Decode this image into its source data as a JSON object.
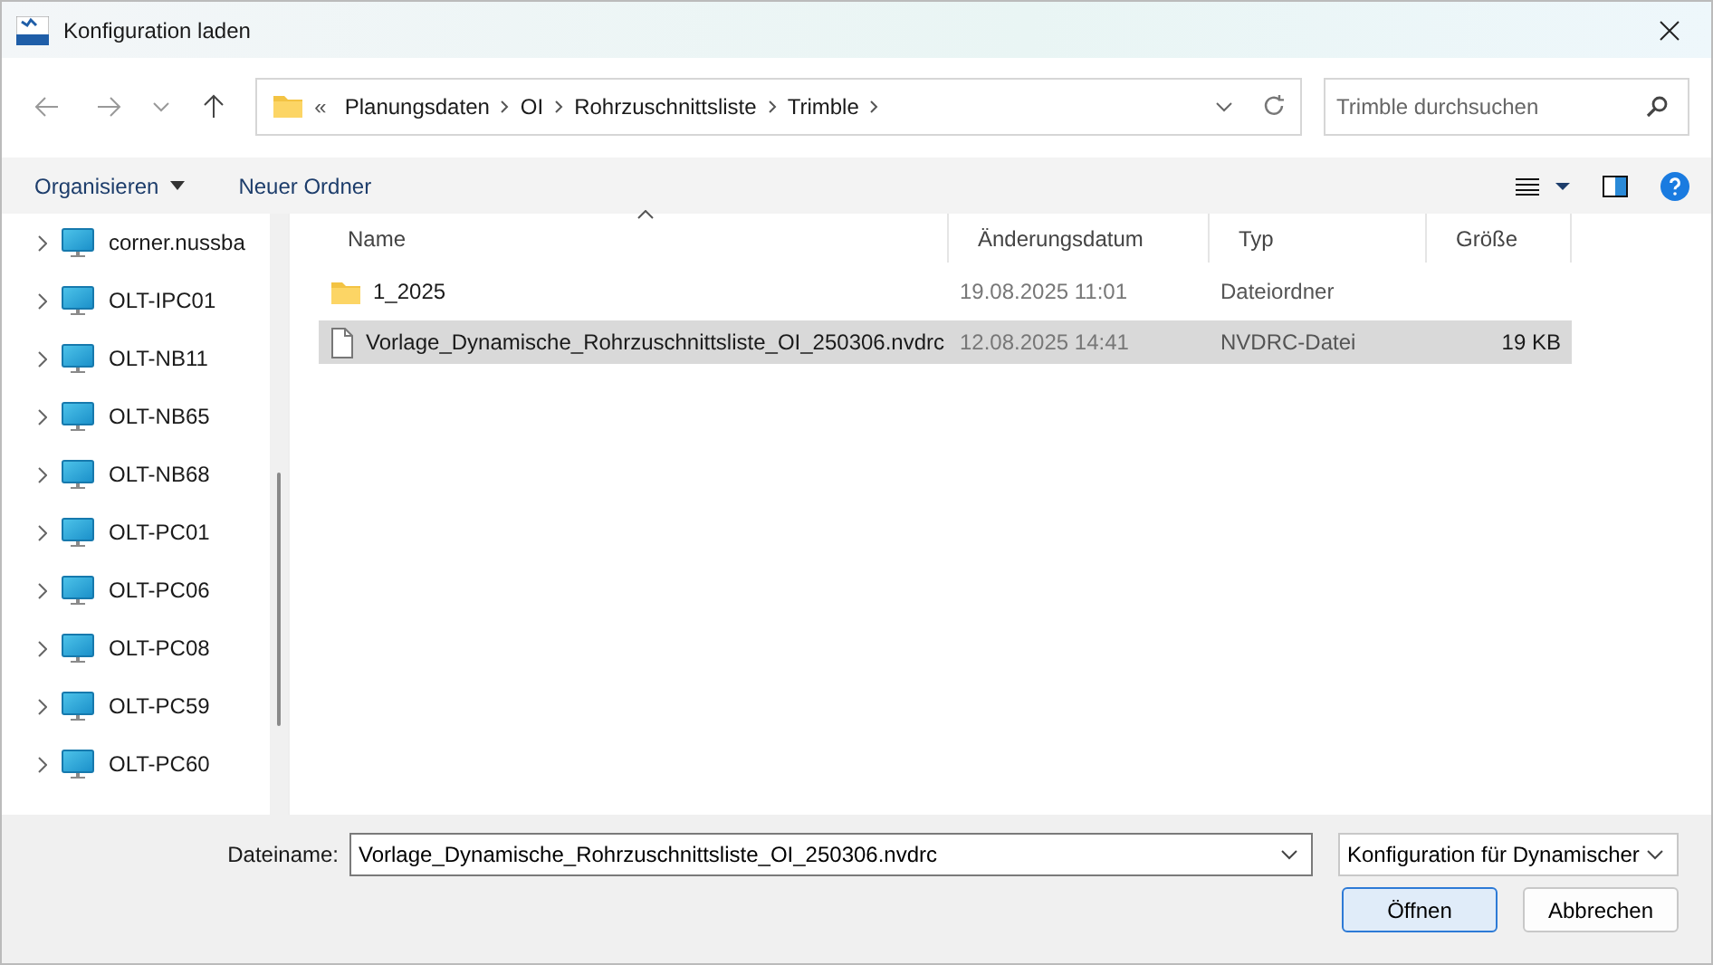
{
  "window": {
    "title": "Konfiguration laden"
  },
  "address": {
    "overflow": "«",
    "crumbs": [
      "Planungsdaten",
      "OI",
      "Rohrzuschnittsliste",
      "Trimble"
    ]
  },
  "search": {
    "placeholder": "Trimble durchsuchen"
  },
  "toolbar": {
    "organize": "Organisieren",
    "new_folder": "Neuer Ordner"
  },
  "sidebar": {
    "items": [
      {
        "label": "corner.nussba"
      },
      {
        "label": "OLT-IPC01"
      },
      {
        "label": "OLT-NB11"
      },
      {
        "label": "OLT-NB65"
      },
      {
        "label": "OLT-NB68"
      },
      {
        "label": "OLT-PC01"
      },
      {
        "label": "OLT-PC06"
      },
      {
        "label": "OLT-PC08"
      },
      {
        "label": "OLT-PC59"
      },
      {
        "label": "OLT-PC60"
      }
    ]
  },
  "table": {
    "columns": [
      "Name",
      "Änderungsdatum",
      "Typ",
      "Größe"
    ],
    "rows": [
      {
        "kind": "folder",
        "name": "1_2025",
        "date": "19.08.2025 11:01",
        "type": "Dateiordner",
        "size": "",
        "selected": false
      },
      {
        "kind": "file",
        "name": "Vorlage_Dynamische_Rohrzuschnittsliste_OI_250306.nvdrc",
        "date": "12.08.2025 14:41",
        "type": "NVDRC-Datei",
        "size": "19 KB",
        "selected": true
      }
    ]
  },
  "footer": {
    "filename_label": "Dateiname:",
    "filename": "Vorlage_Dynamische_Rohrzuschnittsliste_OI_250306.nvdrc",
    "filter": "Konfiguration für Dynamischer",
    "open": "Öffnen",
    "cancel": "Abbrechen"
  }
}
